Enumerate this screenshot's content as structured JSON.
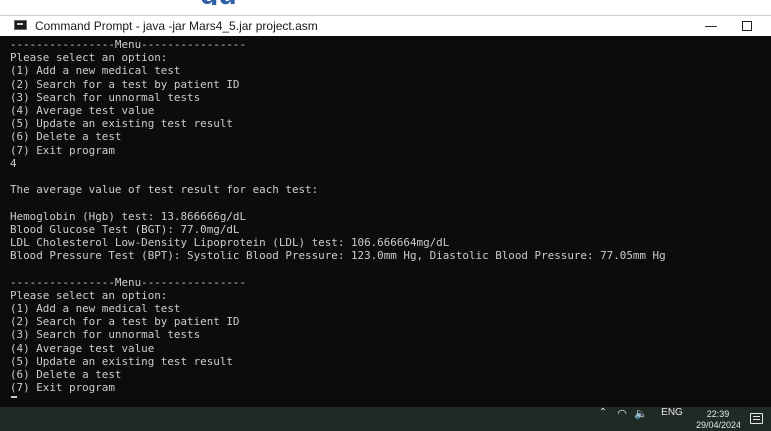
{
  "background": {
    "heading_fragment": "gu"
  },
  "window": {
    "title": "Command Prompt - java  -jar Mars4_5.jar project.asm",
    "controls": {
      "minimize": "—",
      "close": "☐"
    }
  },
  "console": {
    "lines": [
      "----------------Menu----------------",
      "Please select an option:",
      "(1) Add a new medical test",
      "(2) Search for a test by patient ID",
      "(3) Search for unnormal tests",
      "(4) Average test value",
      "(5) Update an existing test result",
      "(6) Delete a test",
      "(7) Exit program",
      "4",
      "",
      "The average value of test result for each test:",
      "",
      "Hemoglobin (Hgb) test: 13.866666g/dL",
      "Blood Glucose Test (BGT): 77.0mg/dL",
      "LDL Cholesterol Low-Density Lipoprotein (LDL) test: 106.666664mg/dL",
      "Blood Pressure Test (BPT): Systolic Blood Pressure: 123.0mm Hg, Diastolic Blood Pressure: 77.05mm Hg",
      "",
      "----------------Menu----------------",
      "Please select an option:",
      "(1) Add a new medical test",
      "(2) Search for a test by patient ID",
      "(3) Search for unnormal tests",
      "(4) Average test value",
      "(5) Update an existing test result",
      "(6) Delete a test",
      "(7) Exit program"
    ],
    "colors": {
      "background": "#0c0c0c",
      "text": "#cccccc"
    }
  },
  "taskbar": {
    "tray": {
      "chevron": "^",
      "wifi": "((·",
      "volume": "🔈",
      "language": "ENG"
    },
    "clock": {
      "time": "22:39",
      "date": "29/04/2024"
    },
    "icons": [
      "chevron-up-icon",
      "wifi-icon",
      "volume-icon",
      "notification-icon"
    ]
  }
}
